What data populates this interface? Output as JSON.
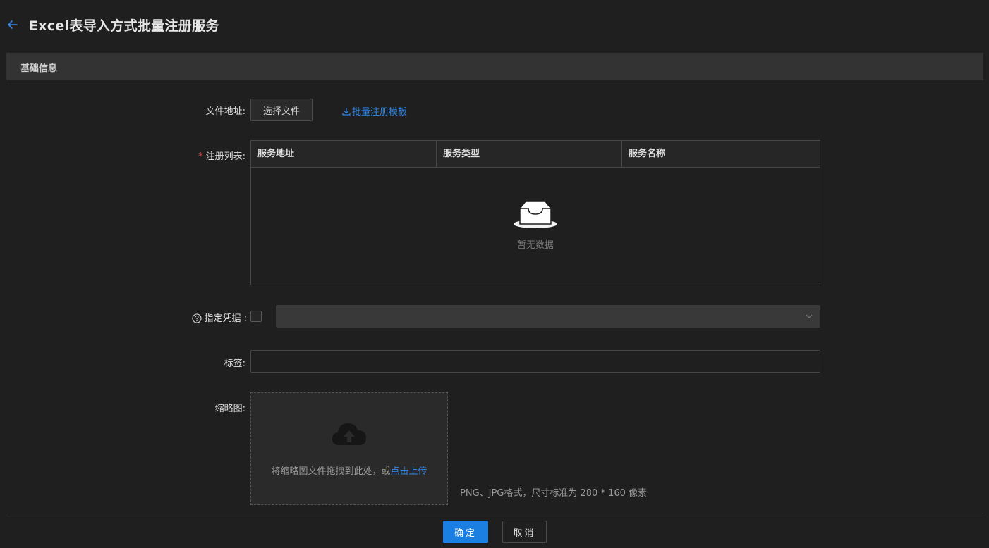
{
  "header": {
    "title": "Excel表导入方式批量注册服务",
    "back_icon": "arrow-left-icon"
  },
  "section": {
    "title": "基础信息"
  },
  "form": {
    "file_address": {
      "label": "文件地址:",
      "button": "选择文件",
      "template_link": "批量注册模板",
      "template_icon": "download-icon"
    },
    "register_list": {
      "required_mark": "*",
      "label": "注册列表:",
      "columns": [
        "服务地址",
        "服务类型",
        "服务名称"
      ],
      "empty_text": "暂无数据",
      "empty_icon": "empty-inbox-icon"
    },
    "credential": {
      "label": "指定凭据 :",
      "help_icon": "question-circle-icon",
      "checked": false,
      "selected_value": "",
      "arrow_icon": "chevron-down-icon"
    },
    "tags": {
      "label": "标签:",
      "value": "",
      "placeholder": ""
    },
    "thumbnail": {
      "label": "缩略图:",
      "drop_text": "将缩略图文件拖拽到此处，或",
      "click_text": "点击上传",
      "upload_icon": "cloud-upload-icon",
      "hint": "PNG、JPG格式，尺寸标准为 280 * 160 像素"
    }
  },
  "footer": {
    "confirm": "确定",
    "cancel": "取消"
  },
  "colors": {
    "accent": "#1a7fe0",
    "link": "#2f86e8",
    "background": "#1f1f1f",
    "section_bar": "#333333",
    "required": "#e04545"
  }
}
